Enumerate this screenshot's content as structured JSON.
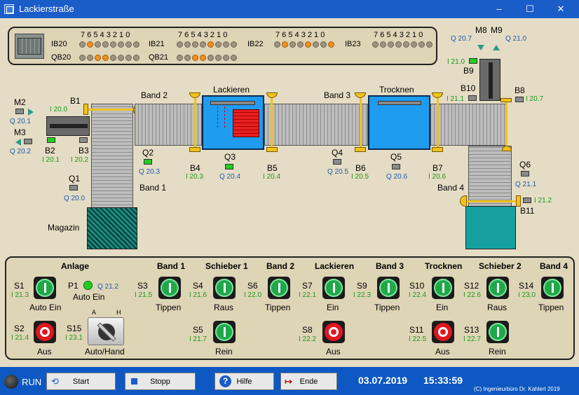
{
  "window": {
    "title": "Lackierstraße",
    "minimize": "–",
    "maximize": "☐",
    "close": "✕"
  },
  "io": {
    "bits": "7 6 5 4 3 2 1 0",
    "ib20": "IB20",
    "qb20": "QB20",
    "ib21": "IB21",
    "qb21": "QB21",
    "ib22": "IB22",
    "ib23": "IB23",
    "ib20_on": [
      6
    ],
    "qb20_on": [
      4,
      5
    ],
    "ib21_on": [
      3
    ],
    "qb21_on": [
      4,
      5
    ],
    "ib22_on": [
      0,
      3,
      6
    ],
    "ib23_on": []
  },
  "plant": {
    "m2": "M2",
    "m2_io": "Q 20.1",
    "m3": "M3",
    "m3_io": "Q 20.2",
    "b1": "B1",
    "b1_io": "I 20.0",
    "b2": "B2",
    "b2_io": "I 20.1",
    "b3": "B3",
    "b3_io": "I 20.2",
    "q1": "Q1",
    "q1_io": "Q 20.0",
    "magazin": "Magazin",
    "band1": "Band 1",
    "band2": "Band 2",
    "band3": "Band 3",
    "band4": "Band 4",
    "q2": "Q2",
    "q2_io": "Q 20.3",
    "lackieren": "Lackieren",
    "trocknen": "Trocknen",
    "b4": "B4",
    "b4_io": "I 20.3",
    "q3": "Q3",
    "q3_io": "Q 20.4",
    "b5": "B5",
    "b5_io": "I 20.4",
    "q4": "Q4",
    "q4_io": "Q 20.5",
    "b6": "B6",
    "b6_io": "I 20.5",
    "q5": "Q5",
    "q5_io": "Q 20.6",
    "b7": "B7",
    "b7_io": "I 20.6",
    "m8": "M8",
    "m8_io": "Q 20.7",
    "m9": "M9",
    "m9_io": "Q 21.0",
    "b9": "B9",
    "b9_io": "I 21.0",
    "b10": "B10",
    "b10_io": "I 21.1",
    "b8": "B8",
    "b8_io": "I 20.7",
    "q6": "Q6",
    "q6_io": "Q 21.1",
    "b11": "B11",
    "b11_io": "I 21.2"
  },
  "controls": {
    "anlage": "Anlage",
    "h_band1": "Band 1",
    "h_schieber1": "Schieber 1",
    "h_band2": "Band 2",
    "h_lackieren": "Lackieren",
    "h_band3": "Band 3",
    "h_trocknen": "Trocknen",
    "h_schieber2": "Schieber 2",
    "h_band4": "Band 4",
    "s1": "S1",
    "s1_io": "I 21.3",
    "s1_label": "Auto Ein",
    "p1": "P1",
    "p1_io": "Q 21.2",
    "p1_label": "Auto Ein",
    "s2": "S2",
    "s2_io": "I 21.4",
    "s2_label": "Aus",
    "s15": "S15",
    "s15_io": "I 23.1",
    "s15_a": "A",
    "s15_h": "H",
    "s15_label": "Auto/Hand",
    "s3": "S3",
    "s3_io": "I 21.5",
    "s3_label": "Tippen",
    "s4": "S4",
    "s4_io": "I 21.6",
    "s4_label": "Raus",
    "s5": "S5",
    "s5_io": "I 21.7",
    "s5_label": "Rein",
    "s6": "S6",
    "s6_io": "I 22.0",
    "s6_label": "Tippen",
    "s7": "S7",
    "s7_io": "I 22.1",
    "s7_label": "Ein",
    "s8": "S8",
    "s8_io": "I 22.2",
    "s8_label": "Aus",
    "s9": "S9",
    "s9_io": "I 22.3",
    "s9_label": "Tippen",
    "s10": "S10",
    "s10_io": "I 22.4",
    "s10_label": "Ein",
    "s11": "S11",
    "s11_io": "I 22.5",
    "s11_label": "Aus",
    "s12": "S12",
    "s12_io": "I 22.6",
    "s12_label": "Raus",
    "s13": "S13",
    "s13_io": "I 22.7",
    "s13_label": "Rein",
    "s14": "S14",
    "s14_io": "I 23.0",
    "s14_label": "Tippen"
  },
  "status": {
    "run": "RUN",
    "start": "Start",
    "stopp": "Stopp",
    "hilfe": "Hilfe",
    "ende": "Ende",
    "date": "03.07.2019",
    "time": "15:33:59",
    "copyright": "(C) Ingenieurbüro Dr. Kahlert 2019"
  },
  "colors": {
    "accent": "#0d58c2",
    "sensor_on": "#22cc22",
    "led_on": "#f0901c",
    "station": "#1e9cf0"
  }
}
